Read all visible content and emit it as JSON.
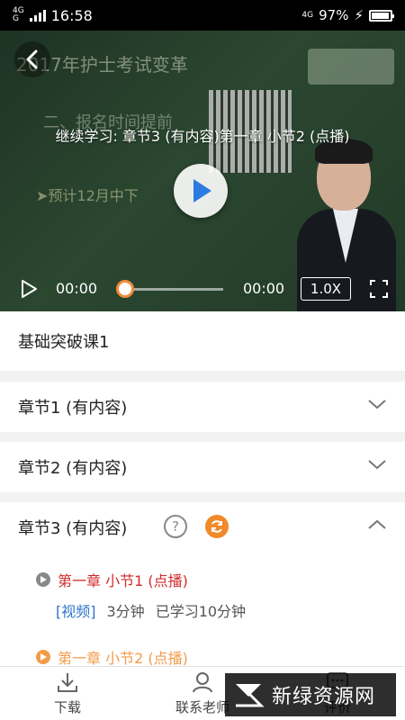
{
  "status_bar": {
    "signal_labels": [
      "4G",
      "G"
    ],
    "time": "16:58",
    "right_signal": "4G",
    "battery": "97%"
  },
  "video": {
    "board_text": "2017年护士考试变革",
    "board_line2": "二、报名时间提前",
    "board_line3": "➤预计12月中下",
    "title": "继续学习: 章节3 (有内容)第一章 小节2 (点播)",
    "current_time": "00:00",
    "total_time": "00:00",
    "speed": "1.0X",
    "progress": 0
  },
  "course": {
    "title": "基础突破课1"
  },
  "chapters": [
    {
      "label": "章节1 (有内容)"
    },
    {
      "label": "章节2  (有内容)"
    },
    {
      "label": "章节3 (有内容)"
    }
  ],
  "lessons": [
    {
      "title": "第一章 小节1 (点播)",
      "tag": "[视频]",
      "duration": "3分钟",
      "studied": "已学习10分钟"
    },
    {
      "title": "第一章 小节2 (点播)"
    }
  ],
  "bottom_nav": {
    "download": "下载",
    "contact": "联系老师",
    "review": "评价"
  },
  "watermark": {
    "text": "新绿资源网"
  },
  "colors": {
    "accent_orange": "#f08a2a",
    "active_red": "#d12b2b",
    "tag_blue": "#2f74c9"
  }
}
